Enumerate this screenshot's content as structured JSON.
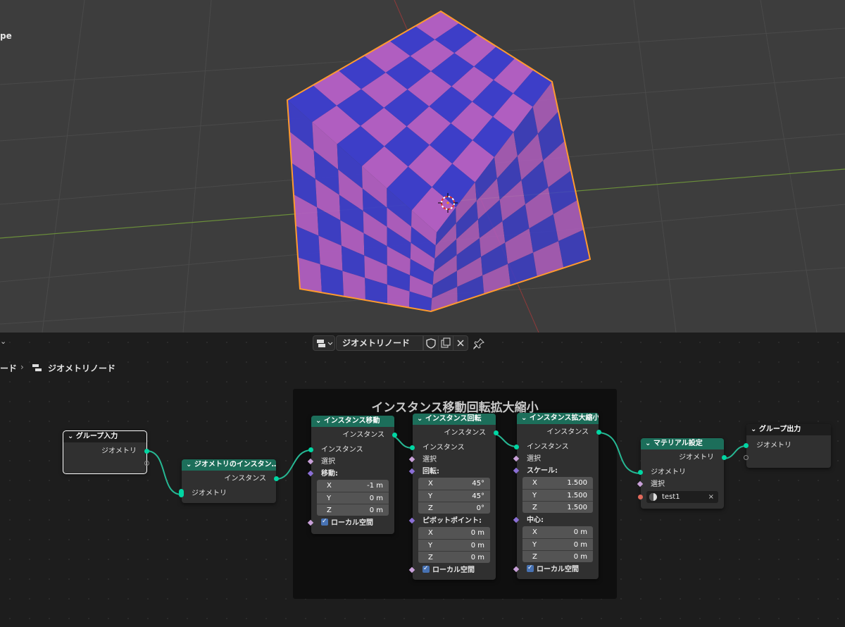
{
  "viewport": {
    "corner_label": "pe"
  },
  "editor": {
    "header_arrow": "⌄",
    "tree_name": "ジオメトリノード",
    "breadcrumb_parent": "ード",
    "breadcrumb_sep": "›",
    "breadcrumb_current": "ジオメトリノード"
  },
  "frame": {
    "label": "インスタンス移動回転拡大縮小"
  },
  "nodes": {
    "group_input": {
      "title": "グループ入力",
      "out_geometry": "ジオメトリ"
    },
    "geo_to_instance": {
      "title": "ジオメトリのインスタン…",
      "out_instances": "インスタンス",
      "in_geometry": "ジオメトリ"
    },
    "translate": {
      "title": "インスタンス移動",
      "out_instances": "インスタンス",
      "in_instances": "インスタンス",
      "selection": "選択",
      "translation_label": "移動:",
      "x": {
        "label": "X",
        "value": "-1 m"
      },
      "y": {
        "label": "Y",
        "value": "0 m"
      },
      "z": {
        "label": "Z",
        "value": "0 m"
      },
      "local_space": "ローカル空間"
    },
    "rotate": {
      "title": "インスタンス回転",
      "out_instances": "インスタンス",
      "in_instances": "インスタンス",
      "selection": "選択",
      "rotation_label": "回転:",
      "x": {
        "label": "X",
        "value": "45°"
      },
      "y": {
        "label": "Y",
        "value": "45°"
      },
      "z": {
        "label": "Z",
        "value": "0°"
      },
      "pivot_label": "ピボットポイント:",
      "px": {
        "label": "X",
        "value": "0 m"
      },
      "py": {
        "label": "Y",
        "value": "0 m"
      },
      "pz": {
        "label": "Z",
        "value": "0 m"
      },
      "local_space": "ローカル空間"
    },
    "scale": {
      "title": "インスタンス拡大縮小",
      "out_instances": "インスタンス",
      "in_instances": "インスタンス",
      "selection": "選択",
      "scale_label": "スケール:",
      "x": {
        "label": "X",
        "value": "1.500"
      },
      "y": {
        "label": "Y",
        "value": "1.500"
      },
      "z": {
        "label": "Z",
        "value": "1.500"
      },
      "center_label": "中心:",
      "cx": {
        "label": "X",
        "value": "0 m"
      },
      "cy": {
        "label": "Y",
        "value": "0 m"
      },
      "cz": {
        "label": "Z",
        "value": "0 m"
      },
      "local_space": "ローカル空間"
    },
    "set_material": {
      "title": "マテリアル設定",
      "out_geometry": "ジオメトリ",
      "in_geometry": "ジオメトリ",
      "selection": "選択",
      "material": "test1"
    },
    "group_output": {
      "title": "グループ出力",
      "in_geometry": "ジオメトリ"
    }
  },
  "colors": {
    "geometry_header": "#1c6e5a",
    "geometry_socket": "#00d6a3",
    "cube_light": "#b05ec0",
    "cube_dark": "#3d3ec8",
    "selection_outline": "#ff9a2e"
  }
}
